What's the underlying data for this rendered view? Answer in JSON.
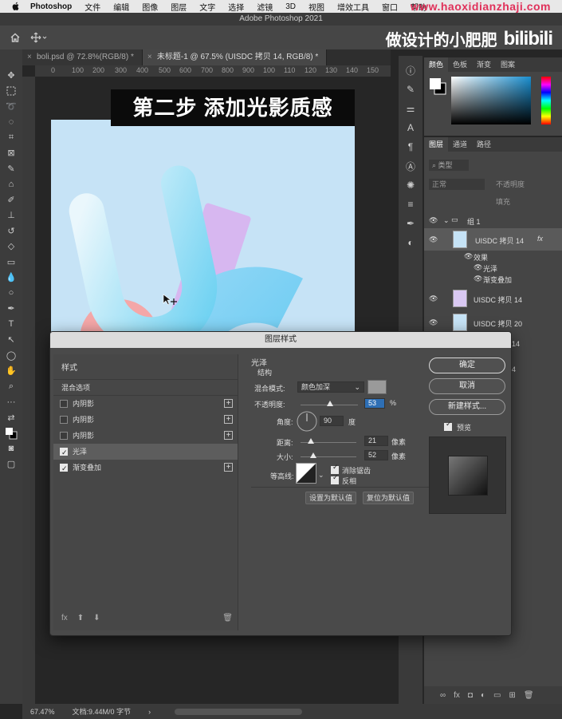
{
  "menubar": {
    "app": "Photoshop",
    "items": [
      "文件",
      "编辑",
      "图像",
      "图层",
      "文字",
      "选择",
      "滤镜",
      "3D",
      "视图",
      "增效工具",
      "窗口",
      "帮助"
    ],
    "watermark": "www.haoxidianzhaji.com"
  },
  "window": {
    "title": "Adobe Photoshop 2021"
  },
  "channel": {
    "author": "做设计的小肥肥",
    "logo": "bilibili"
  },
  "tabs": [
    {
      "label": "boli.psd @ 72.8%(RGB/8) *"
    },
    {
      "label": "未标题-1 @ 67.5% (UISDC 拷贝 14, RGB/8) *"
    }
  ],
  "ruler_ticks": [
    "0",
    "100",
    "200",
    "300",
    "400",
    "500",
    "600",
    "700",
    "800",
    "900",
    "100",
    "110",
    "120",
    "130",
    "140",
    "150",
    "160"
  ],
  "banner": {
    "text": "第二步 添加光影质感"
  },
  "color_panel": {
    "tabs": [
      "颜色",
      "色板",
      "渐变",
      "图案"
    ]
  },
  "layers_panel": {
    "tabs": [
      "图层",
      "通道",
      "路径"
    ],
    "filter_label": "类型",
    "blend_mode": "正常",
    "opacity_label": "不透明度",
    "fill_label": "填充",
    "group_name": "组 1",
    "layers": [
      {
        "name": "UISDC 拷贝 14",
        "fx": "fx"
      },
      {
        "name": "效果"
      },
      {
        "name": "光泽"
      },
      {
        "name": "渐变叠加"
      },
      {
        "name": "UISDC 拷贝 14"
      },
      {
        "name": "UISDC 拷贝 20"
      },
      {
        "name": "14"
      },
      {
        "name": "4"
      }
    ]
  },
  "status": {
    "zoom": "67.47%",
    "doc": "文档:9.44M/0 字节"
  },
  "dialog": {
    "title": "图层样式",
    "styles_header": "样式",
    "blend_options": "混合选项",
    "style_items": [
      {
        "label": "内阴影",
        "checked": false,
        "plus": true
      },
      {
        "label": "内阴影",
        "checked": false,
        "plus": true
      },
      {
        "label": "内阴影",
        "checked": false,
        "plus": true
      },
      {
        "label": "光泽",
        "checked": true,
        "plus": false
      },
      {
        "label": "渐变叠加",
        "checked": true,
        "plus": true
      }
    ],
    "section_title": "光泽",
    "subsection": "结构",
    "blend_mode_label": "混合模式:",
    "blend_mode_value": "颜色加深",
    "opacity_label": "不透明度:",
    "opacity_value": "53",
    "opacity_unit": "%",
    "angle_label": "角度:",
    "angle_value": "90",
    "angle_unit": "度",
    "distance_label": "距离:",
    "distance_value": "21",
    "distance_unit": "像素",
    "size_label": "大小:",
    "size_value": "52",
    "size_unit": "像素",
    "contour_label": "等高线:",
    "antialias_label": "消除锯齿",
    "invert_label": "反相",
    "set_default": "设置为默认值",
    "reset_default": "复位为默认值",
    "ok": "确定",
    "cancel": "取消",
    "new_style": "新建样式...",
    "preview": "预览"
  }
}
